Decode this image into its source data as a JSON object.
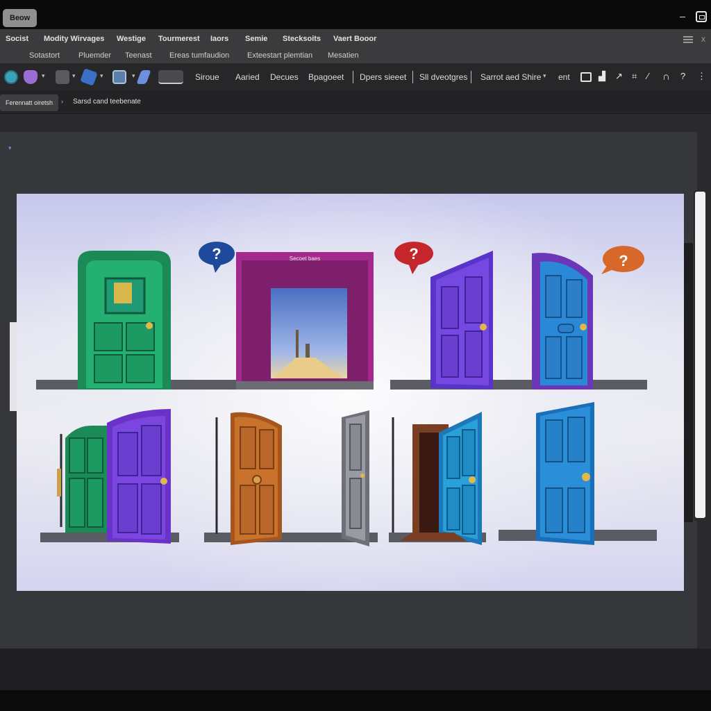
{
  "titlebar": {
    "app_button": "Beow"
  },
  "menubar": {
    "items": [
      "Socist",
      "Modity Wirvages",
      "Westige",
      "Tourmerest",
      "Iaors",
      "Semie",
      "Stecksoits",
      "Vaert Booor"
    ],
    "subitems": [
      "Sotastort",
      "Pluemder",
      "Teenast",
      "Ereas tumfaudion",
      "Exteestart plemtian",
      "Mesatien"
    ]
  },
  "toolbar": {
    "labels": [
      "Siroue",
      "Aaried",
      "Decues",
      "Bpagoeet",
      "Dpers sieeet",
      "Sll dveotgres",
      "Sarrot aed Shire",
      "ent"
    ],
    "icons": [
      "globe-icon",
      "gem-icon",
      "cursor-tool-icon",
      "crystal-icon",
      "image-icon",
      "pen-icon",
      "ruler-icon",
      "comment-icon",
      "chart-icon",
      "send-icon",
      "door-icon",
      "help-icon"
    ],
    "accent_colors": [
      "#3aa2b8",
      "#9a6cd6",
      "#6e8fe0",
      "#5b9cd6"
    ]
  },
  "tabrow": {
    "active_tab": "Ferennatt oiretsh",
    "path": "Sarsd cand teebenate"
  },
  "canvas": {
    "caption": "Secoet baes",
    "question_mark": "?"
  },
  "doors": [
    {
      "id": "green-door",
      "color": "#1fa56a"
    },
    {
      "id": "magenta-archway",
      "color": "#a32a8c"
    },
    {
      "id": "purple-door-open",
      "color": "#6a3fd8"
    },
    {
      "id": "blue-arched-door",
      "color": "#2a88d6"
    },
    {
      "id": "green-purple-double-door",
      "color": "#7a3fd8"
    },
    {
      "id": "orange-door",
      "color": "#c9722c"
    },
    {
      "id": "gray-door",
      "color": "#8a8a92"
    },
    {
      "id": "cyan-door-open",
      "color": "#2aa0d8"
    },
    {
      "id": "blue-door",
      "color": "#2b8ed8"
    }
  ],
  "bubbles": [
    {
      "color": "#1e4a9c"
    },
    {
      "color": "#c4262c"
    },
    {
      "color": "#d8682a"
    }
  ]
}
